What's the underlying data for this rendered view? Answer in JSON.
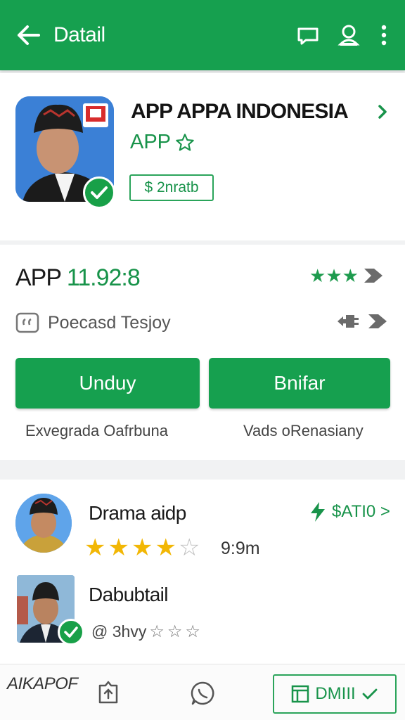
{
  "appbar": {
    "title": "Datail",
    "icons": [
      "back-arrow-icon",
      "chat-icon",
      "profile-icon",
      "more-vert-icon"
    ]
  },
  "app": {
    "name": "APP APPA INDONESIA",
    "subtitle": "APP",
    "tag": "$ 2nratb"
  },
  "release": {
    "version_prefix": "APP",
    "version": "11.92:8",
    "info_label": "Poecasd Tesjoy",
    "download_button": "Unduy",
    "share_button": "Bnifar",
    "footer_left": "Exvegrada Oafrbuna",
    "footer_right": "Vads oRenasiany"
  },
  "reviews": [
    {
      "name": "Drama aidp",
      "rating": 4,
      "time": "9:9m",
      "action": "$ATI0 >"
    },
    {
      "name": "Dabubtail",
      "meta": "@ 3hvy"
    }
  ],
  "bottombar": {
    "logo": "AIKAPOF",
    "primary_button": "DMIII"
  },
  "colors": {
    "primary": "#16a04f",
    "accent_text": "#18934a",
    "star": "#f2b705"
  }
}
